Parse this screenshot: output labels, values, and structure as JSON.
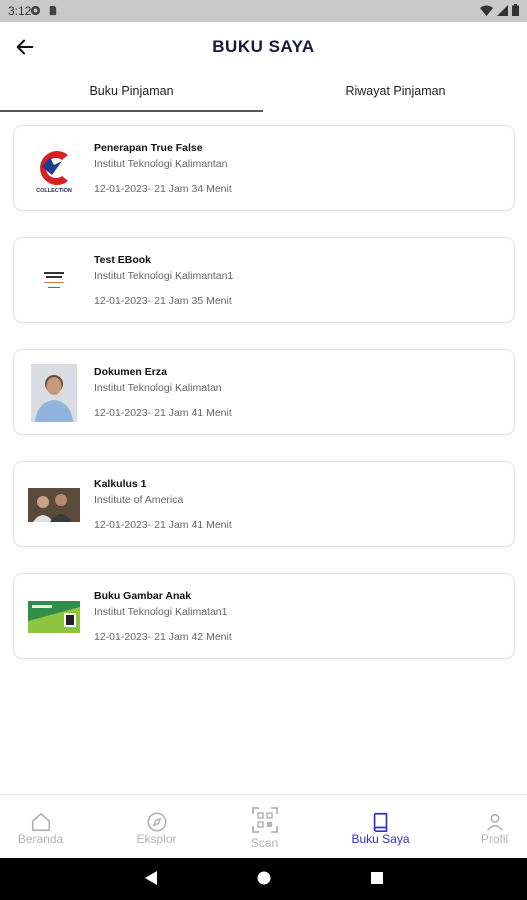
{
  "status_bar": {
    "time": "3:12"
  },
  "header": {
    "title": "BUKU SAYA"
  },
  "tabs": [
    {
      "label": "Buku Pinjaman",
      "active": true
    },
    {
      "label": "Riwayat Pinjaman",
      "active": false
    }
  ],
  "books": [
    {
      "title": "Penerapan True False",
      "institution": "Institut Teknologi Kalimantan",
      "date": "12-01-2023- 21 Jam 34 Menit",
      "cover_text": "COLLECTION"
    },
    {
      "title": "Test EBook",
      "institution": "Institut Teknologi Kalimantan1",
      "date": "12-01-2023- 21 Jam 35 Menit"
    },
    {
      "title": "Dokumen Erza",
      "institution": "Institut Teknologi Kalimatan",
      "date": "12-01-2023- 21 Jam 41 Menit"
    },
    {
      "title": "Kalkulus 1",
      "institution": "Institute of America",
      "date": "12-01-2023- 21 Jam 41 Menit"
    },
    {
      "title": "Buku Gambar Anak",
      "institution": "Institut Teknologi Kalimatan1",
      "date": "12-01-2023- 21 Jam 42 Menit"
    }
  ],
  "bottom_nav": [
    {
      "label": "Beranda",
      "icon": "home-icon",
      "active": false
    },
    {
      "label": "Eksplor",
      "icon": "compass-icon",
      "active": false
    },
    {
      "label": "Scan",
      "icon": "qr-scan-icon",
      "active": false
    },
    {
      "label": "Buku Saya",
      "icon": "book-icon",
      "active": true
    },
    {
      "label": "Profil",
      "icon": "person-icon",
      "active": false
    }
  ],
  "colors": {
    "accent": "#2f33c9",
    "title": "#151a3d",
    "inactive_nav": "#b3b3b3"
  }
}
